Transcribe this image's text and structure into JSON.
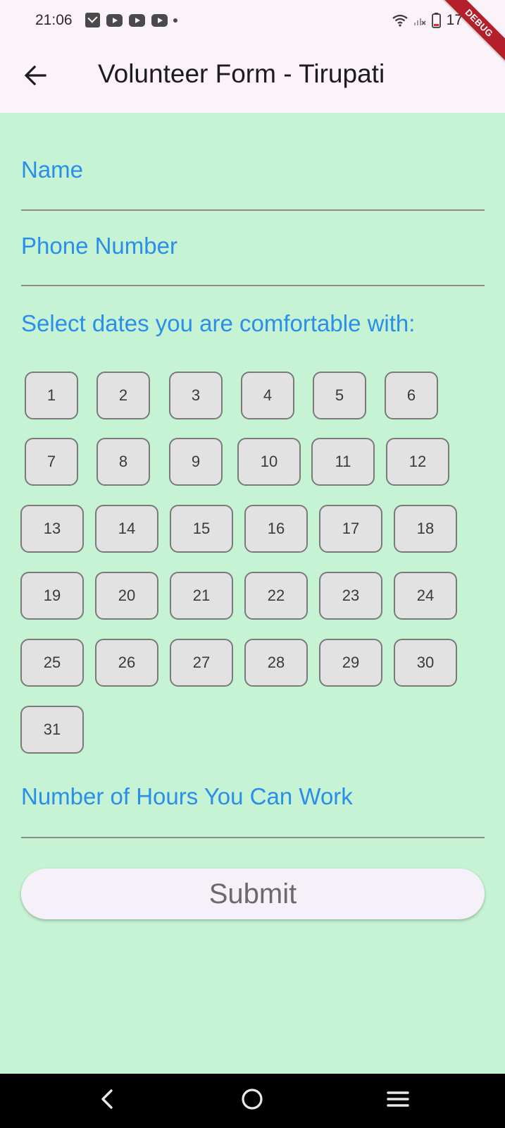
{
  "status_bar": {
    "time": "21:06",
    "battery_level": "17",
    "debug_banner": "DEBUG",
    "notification_icons": [
      "mail-icon",
      "youtube-icon",
      "youtube-icon",
      "youtube-icon",
      "more-dot-icon"
    ],
    "system_icons": [
      "wifi-icon",
      "signal-icon",
      "battery-icon"
    ]
  },
  "app_bar": {
    "title": "Volunteer Form - Tirupati",
    "back_icon": "arrow-left-icon"
  },
  "form": {
    "name_label": "Name",
    "phone_label": "Phone Number",
    "dates_label": "Select dates you are comfortable with:",
    "dates": [
      "1",
      "2",
      "3",
      "4",
      "5",
      "6",
      "7",
      "8",
      "9",
      "10",
      "11",
      "12",
      "13",
      "14",
      "15",
      "16",
      "17",
      "18",
      "19",
      "20",
      "21",
      "22",
      "23",
      "24",
      "25",
      "26",
      "27",
      "28",
      "29",
      "30",
      "31"
    ],
    "hours_label": "Number of Hours You Can Work",
    "submit_label": "Submit"
  },
  "nav_bar": {
    "icons": [
      "nav-back-icon",
      "nav-home-icon",
      "nav-recents-icon"
    ]
  },
  "colors": {
    "background": "#c5f3d3",
    "app_bar": "#fbf2fa",
    "label_accent": "#2a8eea",
    "chip_fill": "#e2e2e2",
    "debug_banner": "#b3202b"
  }
}
